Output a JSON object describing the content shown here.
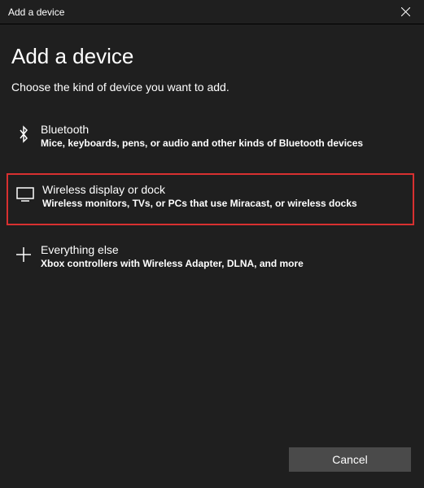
{
  "titlebar": {
    "title": "Add a device"
  },
  "heading": "Add a device",
  "subheading": "Choose the kind of device you want to add.",
  "options": [
    {
      "title": "Bluetooth",
      "desc": "Mice, keyboards, pens, or audio and other kinds of Bluetooth devices"
    },
    {
      "title": "Wireless display or dock",
      "desc": "Wireless monitors, TVs, or PCs that use Miracast, or wireless docks"
    },
    {
      "title": "Everything else",
      "desc": "Xbox controllers with Wireless Adapter, DLNA, and more"
    }
  ],
  "footer": {
    "cancel_label": "Cancel"
  }
}
